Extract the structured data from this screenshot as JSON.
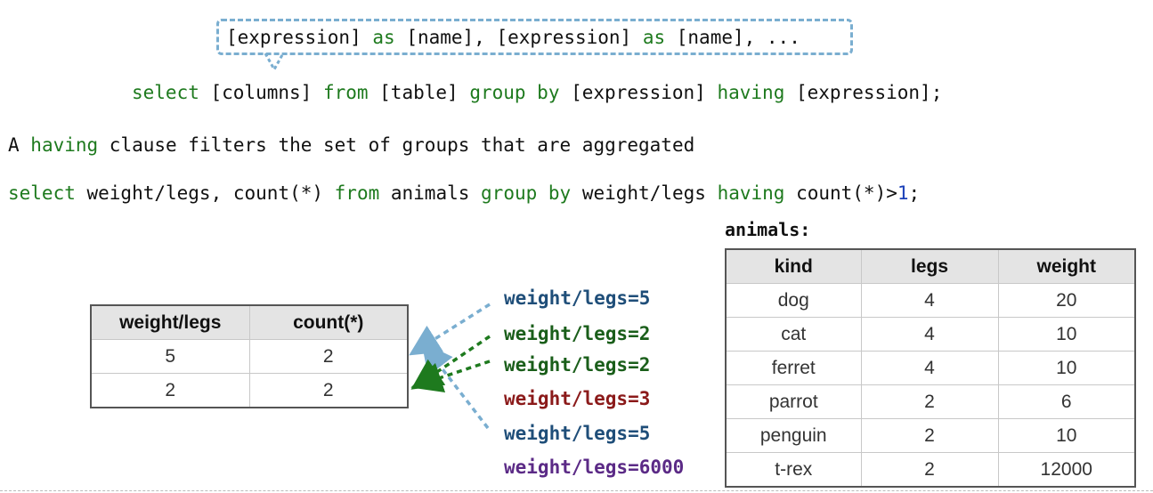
{
  "callout": {
    "parts": [
      {
        "t": "[expression] ",
        "c": ""
      },
      {
        "t": "as",
        "c": "kw"
      },
      {
        "t": " [name], [expression] ",
        "c": ""
      },
      {
        "t": "as",
        "c": "kw"
      },
      {
        "t": " [name], ...",
        "c": ""
      }
    ]
  },
  "syntax_line": {
    "parts": [
      {
        "t": "select",
        "c": "kw"
      },
      {
        "t": " [columns] ",
        "c": ""
      },
      {
        "t": "from",
        "c": "kw"
      },
      {
        "t": " [table] ",
        "c": ""
      },
      {
        "t": "group by",
        "c": "kw"
      },
      {
        "t": " [expression] ",
        "c": ""
      },
      {
        "t": "having",
        "c": "kw"
      },
      {
        "t": " [expression];",
        "c": ""
      }
    ]
  },
  "description": {
    "parts": [
      {
        "t": "A ",
        "c": ""
      },
      {
        "t": "having",
        "c": "kw"
      },
      {
        "t": " clause filters the set of groups that are aggregated",
        "c": ""
      }
    ]
  },
  "query": {
    "parts": [
      {
        "t": "select",
        "c": "kw"
      },
      {
        "t": " weight/legs, count(*) ",
        "c": ""
      },
      {
        "t": "from",
        "c": "kw"
      },
      {
        "t": " animals ",
        "c": ""
      },
      {
        "t": "group by",
        "c": "kw"
      },
      {
        "t": " weight/legs ",
        "c": ""
      },
      {
        "t": "having",
        "c": "kw"
      },
      {
        "t": " count(*)>",
        "c": ""
      },
      {
        "t": "1",
        "c": "num"
      },
      {
        "t": ";",
        "c": ""
      }
    ]
  },
  "animals_title": "animals:",
  "animals_table": {
    "headers": [
      "kind",
      "legs",
      "weight"
    ],
    "rows": [
      [
        "dog",
        "4",
        "20"
      ],
      [
        "cat",
        "4",
        "10"
      ],
      [
        "ferret",
        "4",
        "10"
      ],
      [
        "parrot",
        "2",
        "6"
      ],
      [
        "penguin",
        "2",
        "10"
      ],
      [
        "t-rex",
        "2",
        "12000"
      ]
    ]
  },
  "result_table": {
    "headers": [
      "weight/legs",
      "count(*)"
    ],
    "rows": [
      [
        "5",
        "2"
      ],
      [
        "2",
        "2"
      ]
    ]
  },
  "groups": [
    {
      "label": "weight/legs=5",
      "color": "#1f4e79"
    },
    {
      "label": "weight/legs=2",
      "color": "#1a5e1a"
    },
    {
      "label": "weight/legs=2",
      "color": "#1a5e1a"
    },
    {
      "label": "weight/legs=3",
      "color": "#8b1a1a"
    },
    {
      "label": "weight/legs=5",
      "color": "#1f4e79"
    },
    {
      "label": "weight/legs=6000",
      "color": "#5b2a86"
    }
  ],
  "colors": {
    "keyword": "#1e7a1e",
    "number": "#1a3fb8",
    "callout_border": "#7aaed0",
    "arrow_blue": "#7aaed0",
    "arrow_green": "#1e7a1e"
  }
}
